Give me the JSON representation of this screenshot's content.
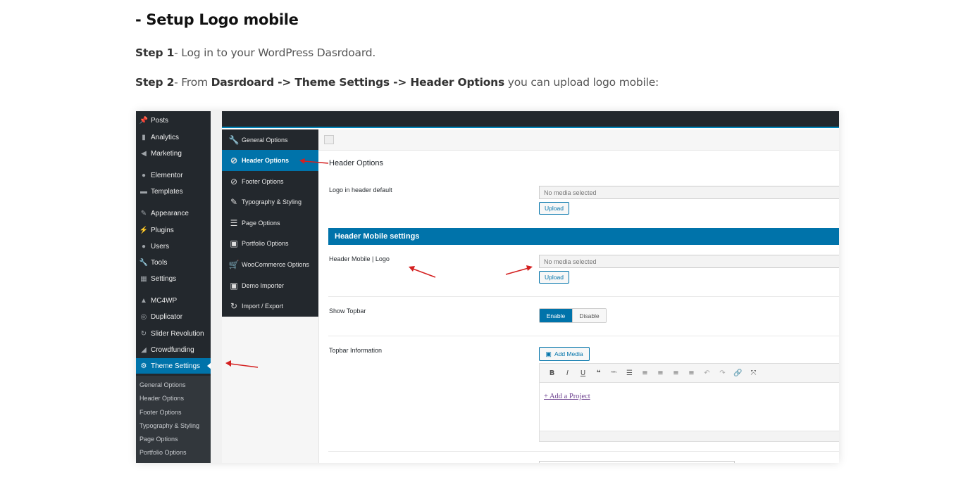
{
  "doc": {
    "title": "- Setup Logo mobile",
    "step1": {
      "label": "Step 1",
      "text": "- Log in to your WordPress Dasrdoard."
    },
    "step2": {
      "label": "Step 2",
      "text_a": "- From ",
      "path": "Dasrdoard -> Theme Settings -> Header Options",
      "text_b": " you can upload logo mobile:"
    }
  },
  "wp_menu": {
    "items": [
      {
        "label": "Posts",
        "icon": "pin-icon"
      },
      {
        "label": "Analytics",
        "icon": "bar-chart-icon"
      },
      {
        "label": "Marketing",
        "icon": "megaphone-icon"
      },
      {
        "label": "Elementor",
        "icon": "elementor-icon"
      },
      {
        "label": "Templates",
        "icon": "folder-icon"
      },
      {
        "label": "Appearance",
        "icon": "brush-icon"
      },
      {
        "label": "Plugins",
        "icon": "plug-icon"
      },
      {
        "label": "Users",
        "icon": "user-icon"
      },
      {
        "label": "Tools",
        "icon": "wrench-icon"
      },
      {
        "label": "Settings",
        "icon": "settings-icon"
      },
      {
        "label": "MC4WP",
        "icon": "mc4wp-icon"
      },
      {
        "label": "Duplicator",
        "icon": "duplicator-icon"
      },
      {
        "label": "Slider Revolution",
        "icon": "refresh-icon"
      },
      {
        "label": "Crowdfunding",
        "icon": "crowdfunding-icon"
      },
      {
        "label": "Theme Settings",
        "icon": "gear-icon"
      }
    ],
    "submenu": [
      "General Options",
      "Header Options",
      "Footer Options",
      "Typography & Styling",
      "Page Options",
      "Portfolio Options"
    ]
  },
  "options_nav": {
    "items": [
      {
        "label": "General Options",
        "icon": "wrench-icon"
      },
      {
        "label": "Header Options",
        "icon": "compass-icon"
      },
      {
        "label": "Footer Options",
        "icon": "compass-icon"
      },
      {
        "label": "Typography & Styling",
        "icon": "pencil-icon"
      },
      {
        "label": "Page Options",
        "icon": "list-icon"
      },
      {
        "label": "Portfolio Options",
        "icon": "window-icon"
      },
      {
        "label": "WooCommerce Options",
        "icon": "cart-icon"
      },
      {
        "label": "Demo Importer",
        "icon": "window-icon"
      },
      {
        "label": "Import / Export",
        "icon": "refresh-icon"
      }
    ]
  },
  "panel": {
    "title": "Header Options",
    "logo_default_label": "Logo in header default",
    "no_media": "No media selected",
    "upload": "Upload",
    "section_mobile": "Header Mobile settings",
    "mobile_logo_label": "Header Mobile | Logo",
    "show_topbar_label": "Show Topbar",
    "enable": "Enable",
    "disable": "Disable",
    "topbar_info_label": "Topbar Information",
    "add_media": "Add Media",
    "editor_link": "+ Add a Project"
  },
  "colors": {
    "wp_dark": "#23282d",
    "wp_blue": "#0073aa",
    "arrow_red": "#d42020"
  }
}
